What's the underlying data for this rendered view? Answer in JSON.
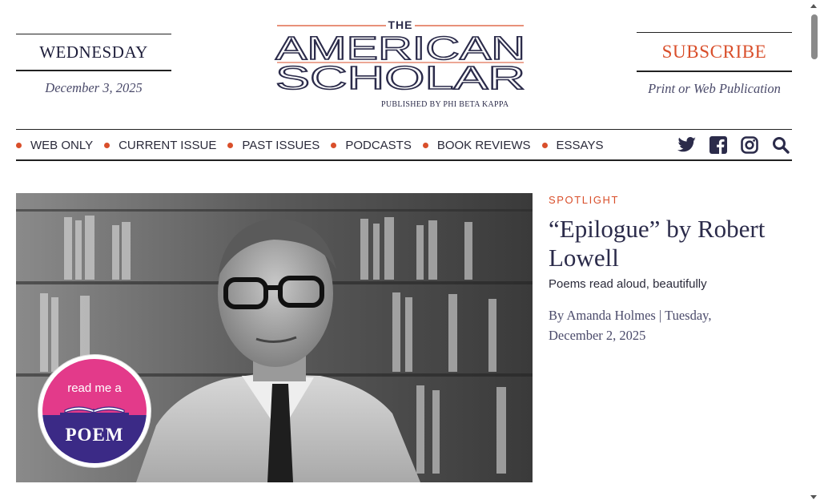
{
  "header": {
    "weekday": "WEDNESDAY",
    "date": "December 3, 2025",
    "logo": {
      "the": "THE",
      "line1": "AMERICAN",
      "line2": "SCHOLAR"
    },
    "published_by": "PUBLISHED BY PHI BETA KAPPA",
    "subscribe_label": "SUBSCRIBE",
    "subscribe_note": "Print or Web Publication"
  },
  "nav": {
    "items": [
      {
        "label": "WEB ONLY"
      },
      {
        "label": "CURRENT ISSUE"
      },
      {
        "label": "PAST ISSUES"
      },
      {
        "label": "PODCASTS"
      },
      {
        "label": "BOOK REVIEWS"
      },
      {
        "label": "ESSAYS"
      }
    ],
    "icons": [
      "twitter-icon",
      "facebook-icon",
      "instagram-icon",
      "search-icon"
    ]
  },
  "feature": {
    "kicker": "SPOTLIGHT",
    "headline": "“Epilogue” by Robert Lowell",
    "dek": "Poems read aloud, beautifully",
    "byline": "By Amanda Holmes | Tuesday, December 2, 2025",
    "badge": {
      "line1": "read me a",
      "line2": "POEM"
    }
  },
  "colors": {
    "accent": "#d94f2b",
    "navy": "#2b2b4a",
    "badge_pink": "#e33a8a",
    "badge_purple": "#3b2a86"
  }
}
